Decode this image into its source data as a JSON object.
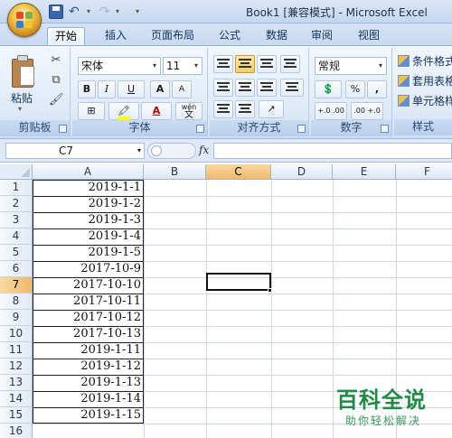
{
  "window": {
    "title": "Book1  [兼容模式] - Microsoft Excel"
  },
  "quick_access": {
    "save_icon": "save-icon",
    "undo_symbol": "↶",
    "redo_symbol": "↷",
    "dropdown_symbol": "▾"
  },
  "tabs": [
    {
      "label": "开始",
      "active": true
    },
    {
      "label": "插入"
    },
    {
      "label": "页面布局"
    },
    {
      "label": "公式"
    },
    {
      "label": "数据"
    },
    {
      "label": "审阅"
    },
    {
      "label": "视图"
    }
  ],
  "ribbon": {
    "clipboard": {
      "group_label": "剪贴板",
      "paste_label": "粘贴"
    },
    "font": {
      "group_label": "字体",
      "font_name": "宋体",
      "font_size": "11",
      "bold": "B",
      "italic": "I",
      "underline": "U",
      "grow": "A",
      "shrink": "A",
      "font_color_letter": "A",
      "wen_label": "wén",
      "wen_char": "文"
    },
    "alignment": {
      "group_label": "对齐方式"
    },
    "number": {
      "group_label": "数字",
      "format": "常规",
      "percent": "%",
      "comma": ",",
      "inc_decimal": "+.0 .00",
      "dec_decimal": ".00 +.0"
    },
    "styles": {
      "group_label": "样式",
      "conditional": "条件格式",
      "table": "套用表格",
      "cell": "单元格样"
    }
  },
  "formula_bar": {
    "name_box": "C7",
    "fx_label": "fx",
    "content": ""
  },
  "sheet": {
    "columns": [
      "A",
      "B",
      "C",
      "D",
      "E",
      "F"
    ],
    "selected_column": "C",
    "rows": [
      "1",
      "2",
      "3",
      "4",
      "5",
      "6",
      "7",
      "8",
      "9",
      "10",
      "11",
      "12",
      "13",
      "14",
      "15",
      "16"
    ],
    "selected_row": "7",
    "active_cell": "C7",
    "column_a": [
      "2019-1-1",
      "2019-1-2",
      "2019-1-3",
      "2019-1-4",
      "2019-1-5",
      "2017-10-9",
      "2017-10-10",
      "2017-10-11",
      "2017-10-12",
      "2017-10-13",
      "2019-1-11",
      "2019-1-12",
      "2019-1-13",
      "2019-1-14",
      "2019-1-15"
    ]
  },
  "watermark": {
    "title": "百科全说",
    "subtitle": "助你轻松解决"
  }
}
